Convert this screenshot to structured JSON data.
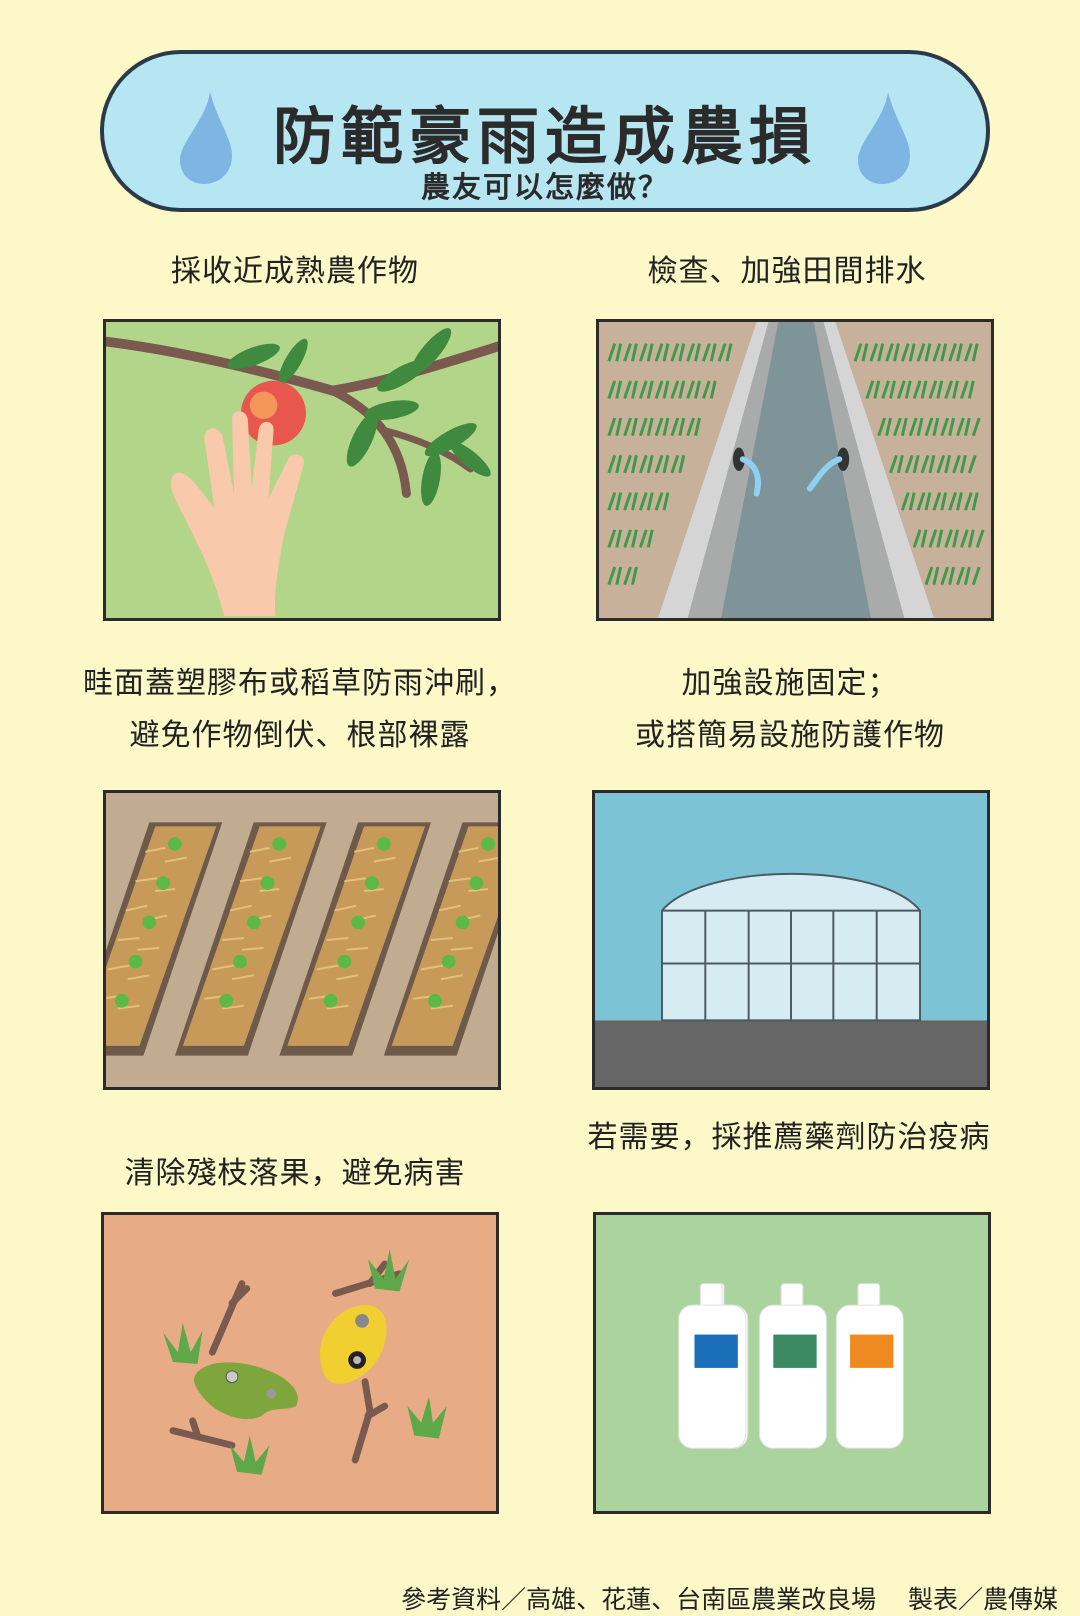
{
  "header": {
    "title": "防範豪雨造成農損",
    "subtitle": "農友可以怎麼做？",
    "icons": [
      "water-drop-icon",
      "water-drop-icon"
    ],
    "colors": {
      "banner": "#b6e6f1",
      "background": "#fdf8c8",
      "drop": "#7fb5e3"
    }
  },
  "tips": [
    {
      "caption": "採收近成熟農作物",
      "illustration": "hand-picking-fruit"
    },
    {
      "caption": "檢查、加強田間排水",
      "illustration": "drainage-ditch"
    },
    {
      "caption": "畦面蓋塑膠布或稻草防雨沖刷，\n避免作物倒伏、根部裸露",
      "illustration": "straw-mulched-beds"
    },
    {
      "caption": "加強設施固定；\n或搭簡易設施防護作物",
      "illustration": "greenhouse"
    },
    {
      "caption": "清除殘枝落果，避免病害",
      "illustration": "fallen-fruit-and-branches"
    },
    {
      "caption": "若需要，採推薦藥劑防治疫病",
      "illustration": "pesticide-bottles"
    }
  ],
  "footer": {
    "reference": "參考資料／高雄、花蓮、台南區農業改良場",
    "producer": "製表／農傳媒"
  }
}
